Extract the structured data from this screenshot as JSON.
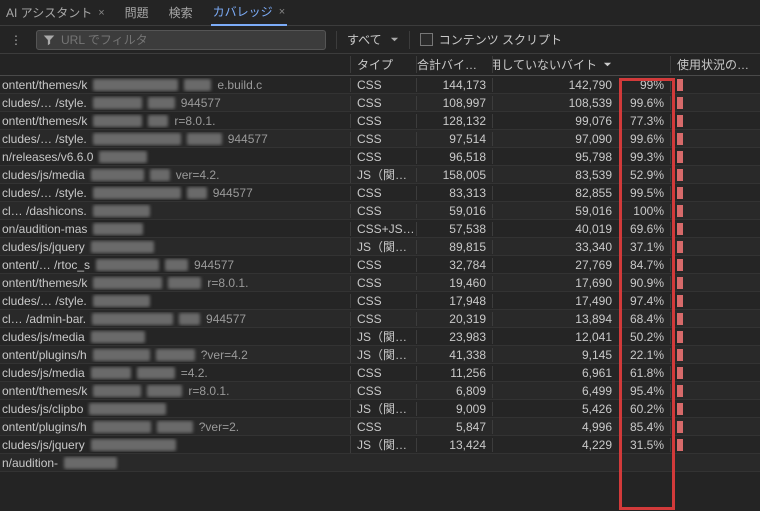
{
  "tabs": {
    "ai": "AI アシスタント",
    "issues": "問題",
    "search": "検索",
    "coverage": "カバレッジ"
  },
  "toolbar": {
    "filter_placeholder": "URL でフィルタ",
    "all": "すべて",
    "content_scripts": "コンテンツ スクリプト"
  },
  "headers": {
    "type": "タイプ",
    "total_bytes": "合計バイト数",
    "unused_bytes": "使用していないバイト",
    "visualization": "使用状況の可視化"
  },
  "rows": [
    {
      "url_start": "ontent/themes/k",
      "url_end": "e.build.c",
      "type": "CSS",
      "total": "144,173",
      "unused": "142,790",
      "pct": "99%"
    },
    {
      "url_start": "cludes/… /style.",
      "url_end": "944577",
      "type": "CSS",
      "total": "108,997",
      "unused": "108,539",
      "pct": "99.6%"
    },
    {
      "url_start": "ontent/themes/k",
      "url_end": "r=8.0.1.",
      "type": "CSS",
      "total": "128,132",
      "unused": "99,076",
      "pct": "77.3%"
    },
    {
      "url_start": "cludes/… /style.",
      "url_end": "944577",
      "type": "CSS",
      "total": "97,514",
      "unused": "97,090",
      "pct": "99.6%"
    },
    {
      "url_start": "n/releases/v6.6.0",
      "url_end": "",
      "type": "CSS",
      "total": "96,518",
      "unused": "95,798",
      "pct": "99.3%"
    },
    {
      "url_start": "cludes/js/media",
      "url_end": "ver=4.2.",
      "type": "JS（関…",
      "total": "158,005",
      "unused": "83,539",
      "pct": "52.9%"
    },
    {
      "url_start": "cludes/… /style.",
      "url_end": "944577",
      "type": "CSS",
      "total": "83,313",
      "unused": "82,855",
      "pct": "99.5%"
    },
    {
      "url_start": "cl… /dashicons.",
      "url_end": "",
      "type": "CSS",
      "total": "59,016",
      "unused": "59,016",
      "pct": "100%"
    },
    {
      "url_start": "on/audition-mas",
      "url_end": "",
      "type": "CSS+JS…",
      "total": "57,538",
      "unused": "40,019",
      "pct": "69.6%"
    },
    {
      "url_start": "cludes/js/jquery",
      "url_end": "",
      "type": "JS（関…",
      "total": "89,815",
      "unused": "33,340",
      "pct": "37.1%"
    },
    {
      "url_start": "ontent/… /rtoc_s",
      "url_end": "944577",
      "type": "CSS",
      "total": "32,784",
      "unused": "27,769",
      "pct": "84.7%"
    },
    {
      "url_start": "ontent/themes/k",
      "url_end": "r=8.0.1.",
      "type": "CSS",
      "total": "19,460",
      "unused": "17,690",
      "pct": "90.9%"
    },
    {
      "url_start": "cludes/… /style.",
      "url_end": "",
      "type": "CSS",
      "total": "17,948",
      "unused": "17,490",
      "pct": "97.4%"
    },
    {
      "url_start": "cl… /admin-bar.",
      "url_end": "944577",
      "type": "CSS",
      "total": "20,319",
      "unused": "13,894",
      "pct": "68.4%"
    },
    {
      "url_start": "cludes/js/media",
      "url_end": "",
      "type": "JS（関…",
      "total": "23,983",
      "unused": "12,041",
      "pct": "50.2%"
    },
    {
      "url_start": "ontent/plugins/h",
      "url_end": "?ver=4.2",
      "type": "JS（関…",
      "total": "41,338",
      "unused": "9,145",
      "pct": "22.1%"
    },
    {
      "url_start": "cludes/js/media",
      "url_end": "=4.2.",
      "type": "CSS",
      "total": "11,256",
      "unused": "6,961",
      "pct": "61.8%"
    },
    {
      "url_start": "ontent/themes/k",
      "url_end": "r=8.0.1.",
      "type": "CSS",
      "total": "6,809",
      "unused": "6,499",
      "pct": "95.4%"
    },
    {
      "url_start": "cludes/js/clipbo",
      "url_end": "",
      "type": "JS（関…",
      "total": "9,009",
      "unused": "5,426",
      "pct": "60.2%"
    },
    {
      "url_start": "ontent/plugins/h",
      "url_end": "?ver=2.",
      "type": "CSS",
      "total": "5,847",
      "unused": "4,996",
      "pct": "85.4%"
    },
    {
      "url_start": "cludes/js/jquery",
      "url_end": "",
      "type": "JS（関…",
      "total": "13,424",
      "unused": "4,229",
      "pct": "31.5%"
    },
    {
      "url_start": "n/audition-",
      "url_end": "",
      "type": "",
      "total": "",
      "unused": "",
      "pct": ""
    }
  ]
}
